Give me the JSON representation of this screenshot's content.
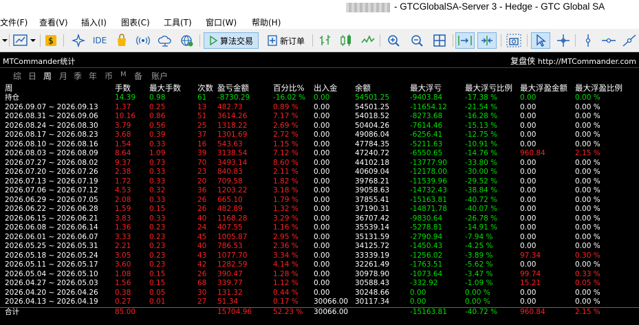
{
  "window": {
    "title": "- GTCGlobalSA-Server 3 - Hedge - GTC Global SA"
  },
  "menu": [
    "文件(F)",
    "查看(V)",
    "插入(I)",
    "图表(C)",
    "工具(T)",
    "窗口(W)",
    "帮助(H)"
  ],
  "toolbar": {
    "ide_label": "IDE",
    "algo_trading_label": "算法交易",
    "new_order_label": "新订单"
  },
  "panel": {
    "title": "MTCommander统计",
    "brand": "复盘侠",
    "url": "http://MTCommander.com"
  },
  "tabs": [
    {
      "label": "综",
      "active": false
    },
    {
      "label": "日",
      "active": false
    },
    {
      "label": "周",
      "active": true
    },
    {
      "label": "月",
      "active": false
    },
    {
      "label": "季",
      "active": false
    },
    {
      "label": "年",
      "active": false
    },
    {
      "label": "币",
      "active": false
    },
    {
      "label": "M",
      "active": false
    },
    {
      "label": "备",
      "active": false
    },
    {
      "label": "账户",
      "active": false
    }
  ],
  "table": {
    "headers": [
      "周",
      "手数",
      "最大手数",
      "次数",
      "盈亏金额",
      "百分比%",
      "出入金",
      "余额",
      "最大浮亏",
      "最大浮亏比例",
      "最大浮盈金额",
      "最大浮盈比例"
    ],
    "holding": {
      "c": [
        "持仓",
        "14.39",
        "0.98",
        "61",
        "-8730.29",
        "-16.02 %",
        "0.00",
        "54501.25",
        "-9403.84",
        "-17.38 %",
        "0.00",
        "0.00 %"
      ],
      "tone": "green"
    },
    "rows": [
      {
        "c": [
          "2026.09.07 ~ 2026.09.13",
          "1.37",
          "0.25",
          "13",
          "482.73",
          "0.89 %",
          "0.00",
          "54501.25",
          "-11654.12",
          "-21.54 %",
          "0.00",
          "0.00 %"
        ]
      },
      {
        "c": [
          "2026.08.31 ~ 2026.09.06",
          "10.16",
          "0.86",
          "51",
          "3614.26",
          "7.17 %",
          "0.00",
          "54018.52",
          "-8273.68",
          "-16.28 %",
          "0.00",
          "0.00 %"
        ]
      },
      {
        "c": [
          "2026.08.24 ~ 2026.08.30",
          "3.79",
          "0.56",
          "25",
          "1318.22",
          "2.69 %",
          "0.00",
          "50404.26",
          "-7614.46",
          "-15.13 %",
          "0.00",
          "0.00 %"
        ]
      },
      {
        "c": [
          "2026.08.17 ~ 2026.08.23",
          "3.68",
          "0.39",
          "37",
          "1301.69",
          "2.72 %",
          "0.00",
          "49086.04",
          "-6256.41",
          "-12.75 %",
          "0.00",
          "0.00 %"
        ]
      },
      {
        "c": [
          "2026.08.10 ~ 2026.08.16",
          "1.54",
          "0.33",
          "16",
          "543.63",
          "1.15 %",
          "0.00",
          "47784.35",
          "-5211.63",
          "-10.91 %",
          "0.00",
          "0.00 %"
        ]
      },
      {
        "c": [
          "2026.08.03 ~ 2026.08.09",
          "8.64",
          "1.09",
          "39",
          "3138.54",
          "7.12 %",
          "0.00",
          "47240.72",
          "-6550.65",
          "-14.76 %",
          "960.84",
          "2.15 %"
        ]
      },
      {
        "c": [
          "2026.07.27 ~ 2026.08.02",
          "9.37",
          "0.73",
          "70",
          "3493.14",
          "8.60 %",
          "0.00",
          "44102.18",
          "-13777.90",
          "-33.80 %",
          "0.00",
          "0.00 %"
        ]
      },
      {
        "c": [
          "2026.07.20 ~ 2026.07.26",
          "2.38",
          "0.33",
          "23",
          "840.83",
          "2.11 %",
          "0.00",
          "40609.04",
          "-12178.00",
          "-30.00 %",
          "0.00",
          "0.00 %"
        ]
      },
      {
        "c": [
          "2026.07.13 ~ 2026.07.19",
          "1.72",
          "0.33",
          "20",
          "709.58",
          "1.82 %",
          "0.00",
          "39768.21",
          "-11539.96",
          "-29.52 %",
          "0.00",
          "0.00 %"
        ]
      },
      {
        "c": [
          "2026.07.06 ~ 2026.07.12",
          "4.53",
          "0.32",
          "36",
          "1203.22",
          "3.18 %",
          "0.00",
          "39058.63",
          "-14732.43",
          "-38.84 %",
          "0.00",
          "0.00 %"
        ]
      },
      {
        "c": [
          "2026.06.29 ~ 2026.07.05",
          "2.08",
          "0.33",
          "26",
          "665.10",
          "1.79 %",
          "0.00",
          "37855.41",
          "-15163.81",
          "-40.72 %",
          "0.00",
          "0.00 %"
        ]
      },
      {
        "c": [
          "2026.06.22 ~ 2026.06.28",
          "1.59",
          "0.15",
          "26",
          "482.89",
          "1.32 %",
          "0.00",
          "37190.31",
          "-14871.78",
          "-40.07 %",
          "0.00",
          "0.00 %"
        ]
      },
      {
        "c": [
          "2026.06.15 ~ 2026.06.21",
          "3.83",
          "0.33",
          "40",
          "1168.28",
          "3.29 %",
          "0.00",
          "36707.42",
          "-9830.64",
          "-26.78 %",
          "0.00",
          "0.00 %"
        ]
      },
      {
        "c": [
          "2026.06.08 ~ 2026.06.14",
          "1.36",
          "0.23",
          "24",
          "407.55",
          "1.16 %",
          "0.00",
          "35539.14",
          "-5278.81",
          "-14.91 %",
          "0.00",
          "0.00 %"
        ]
      },
      {
        "c": [
          "2026.06.01 ~ 2026.06.07",
          "3.33",
          "0.23",
          "45",
          "1005.87",
          "2.95 %",
          "0.00",
          "35131.59",
          "-2790.94",
          "-7.94 %",
          "0.00",
          "0.00 %"
        ]
      },
      {
        "c": [
          "2026.05.25 ~ 2026.05.31",
          "2.21",
          "0.23",
          "40",
          "786.53",
          "2.36 %",
          "0.00",
          "34125.72",
          "-1450.43",
          "-4.25 %",
          "0.00",
          "0.00 %"
        ]
      },
      {
        "c": [
          "2026.05.18 ~ 2026.05.24",
          "3.05",
          "0.23",
          "43",
          "1077.70",
          "3.34 %",
          "0.00",
          "33339.19",
          "-1256.02",
          "-3.89 %",
          "97.34",
          "0.30 %"
        ]
      },
      {
        "c": [
          "2026.05.11 ~ 2026.05.17",
          "3.60",
          "0.23",
          "42",
          "1282.59",
          "4.14 %",
          "0.00",
          "32261.49",
          "-1763.51",
          "-5.62 %",
          "0.00",
          "0.00 %"
        ]
      },
      {
        "c": [
          "2026.05.04 ~ 2026.05.10",
          "1.08",
          "0.15",
          "26",
          "390.47",
          "1.28 %",
          "0.00",
          "30978.90",
          "-1073.64",
          "-3.47 %",
          "99.74",
          "0.33 %"
        ]
      },
      {
        "c": [
          "2026.04.27 ~ 2026.05.03",
          "1.56",
          "0.15",
          "68",
          "339.77",
          "1.12 %",
          "0.00",
          "30588.43",
          "-332.92",
          "-1.09 %",
          "15.21",
          "0.05 %"
        ]
      },
      {
        "c": [
          "2026.04.20 ~ 2026.04.26",
          "0.38",
          "0.05",
          "30",
          "131.32",
          "0.44 %",
          "0.00",
          "30248.66",
          "0.00",
          "0.00 %",
          "0.00",
          "0.00 %"
        ]
      },
      {
        "c": [
          "2026.04.13 ~ 2026.04.19",
          "0.27",
          "0.01",
          "27",
          "51.34",
          "0.17 %",
          "30066.00",
          "30117.34",
          "0.00",
          "0.00 %",
          "0.00",
          "0.00 %"
        ]
      }
    ],
    "total": {
      "c": [
        "合计",
        "85.00",
        "",
        "",
        "15704.96",
        "52.23 %",
        "30066.00",
        "",
        "-15163.81",
        "-40.72 %",
        "960.84",
        "2.15 %"
      ]
    }
  },
  "colors": {
    "positive": "#ff2020",
    "negative": "#00e000",
    "neutral": "#ffffff",
    "toolbar_icon": "#1a5fb4"
  }
}
